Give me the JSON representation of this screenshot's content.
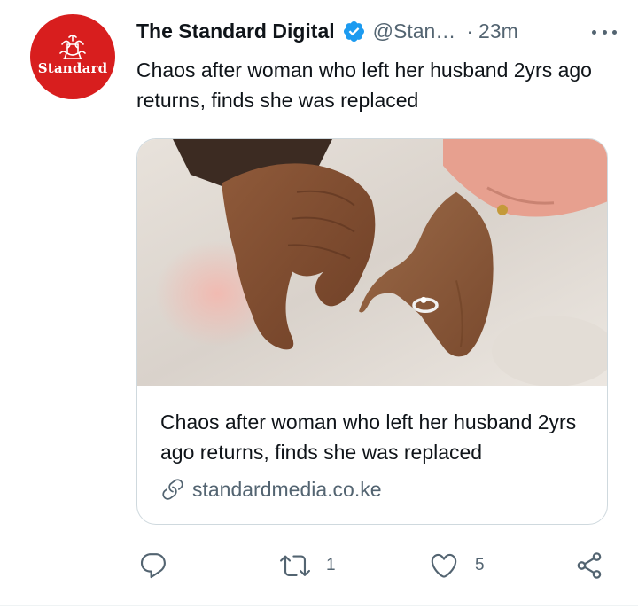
{
  "tweet": {
    "avatar": {
      "label": "Standard",
      "color": "#d81e1e"
    },
    "author": {
      "display_name": "The Standard Digital",
      "handle": "@Stan…",
      "separator": "·",
      "timestamp": "23m",
      "verified_color": "#1d9bf0"
    },
    "text": "Chaos after woman who left her husband 2yrs ago returns, finds she was replaced",
    "card": {
      "image_alt": "Two hands holding pinky fingers",
      "title": "Chaos after woman who left her husband 2yrs ago returns, finds she was replaced",
      "domain": "standardmedia.co.ke"
    },
    "actions": {
      "reply_count": "",
      "retweet_count": "1",
      "like_count": "5"
    }
  },
  "icons": [
    "verified-badge-icon",
    "more-icon",
    "link-icon",
    "reply-icon",
    "retweet-icon",
    "like-icon",
    "share-icon"
  ],
  "colors": {
    "text": "#0f1419",
    "secondary": "#536471",
    "border": "#cfd9de"
  }
}
